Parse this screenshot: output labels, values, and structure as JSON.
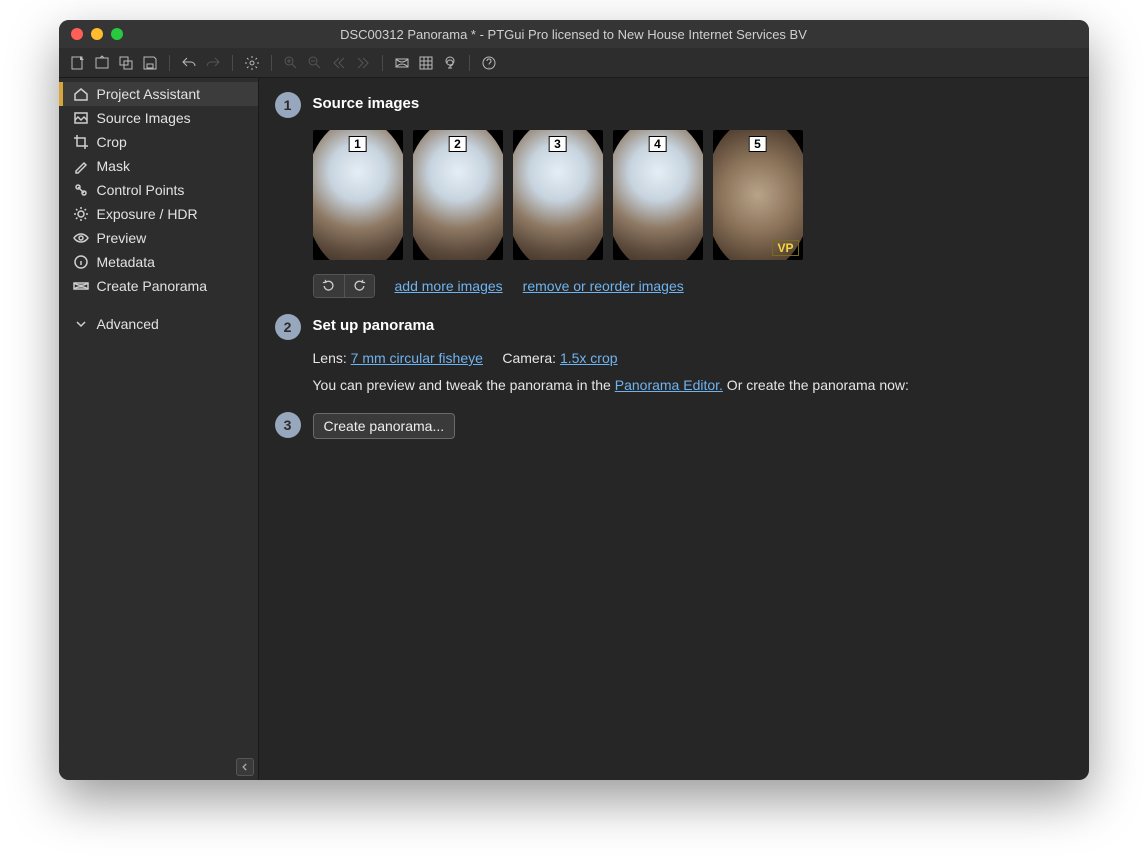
{
  "window": {
    "title": "DSC00312 Panorama * - PTGui Pro licensed to New House Internet Services BV"
  },
  "sidebar": {
    "items": [
      {
        "label": "Project Assistant"
      },
      {
        "label": "Source Images"
      },
      {
        "label": "Crop"
      },
      {
        "label": "Mask"
      },
      {
        "label": "Control Points"
      },
      {
        "label": "Exposure / HDR"
      },
      {
        "label": "Preview"
      },
      {
        "label": "Metadata"
      },
      {
        "label": "Create Panorama"
      }
    ],
    "advanced_label": "Advanced"
  },
  "step1": {
    "num": "1",
    "title": "Source images",
    "thumbs": [
      {
        "num": "1",
        "vp": false,
        "ground": false
      },
      {
        "num": "2",
        "vp": false,
        "ground": false
      },
      {
        "num": "3",
        "vp": false,
        "ground": false
      },
      {
        "num": "4",
        "vp": false,
        "ground": false
      },
      {
        "num": "5",
        "vp": true,
        "ground": true
      }
    ],
    "vp_label": "VP",
    "add_more": "add more images",
    "remove_reorder": "remove or reorder images"
  },
  "step2": {
    "num": "2",
    "title": "Set up panorama",
    "lens_label": "Lens: ",
    "lens_value": "7 mm circular fisheye",
    "camera_label": "Camera: ",
    "camera_value": "1.5x crop",
    "preview_prefix": "You can preview and tweak the panorama in the ",
    "preview_link": "Panorama Editor.",
    "preview_suffix": " Or create the panorama now:"
  },
  "step3": {
    "num": "3",
    "button": "Create panorama..."
  }
}
